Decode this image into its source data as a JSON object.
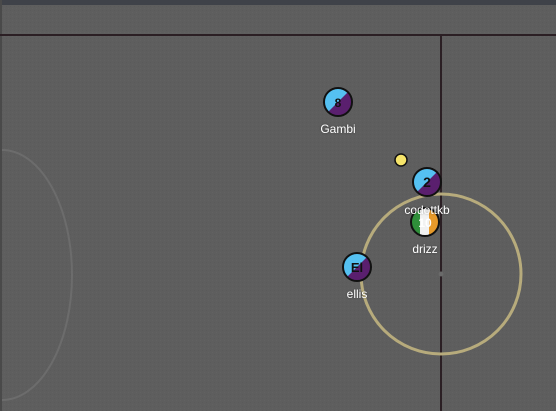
{
  "colors": {
    "field": "#5e5e5e",
    "top_bar": "#3f4249",
    "field_line": "#2b1f24",
    "kickoff_circle": "#b7ab7c",
    "faint_arc": "#6e6e6e",
    "ball": "#f6e46a",
    "team_a_light": "#55c1f2",
    "team_a_dark": "#5a1f6e",
    "irish_green": "#2f8f3a",
    "irish_white": "#f2f2f2",
    "irish_orange": "#e79a2a"
  },
  "players": [
    {
      "id": "gambi",
      "name": "Gambi",
      "avatar_text": "8",
      "team": "team_a"
    },
    {
      "id": "cod",
      "name": "codottkb",
      "avatar_text": "2",
      "team": "team_a"
    },
    {
      "id": "drizz",
      "name": "drizz",
      "avatar_text": "10",
      "team": "irish"
    },
    {
      "id": "ellis",
      "name": "ellis",
      "avatar_text": "El",
      "team": "team_a"
    }
  ],
  "ball": {
    "label": "ball"
  }
}
